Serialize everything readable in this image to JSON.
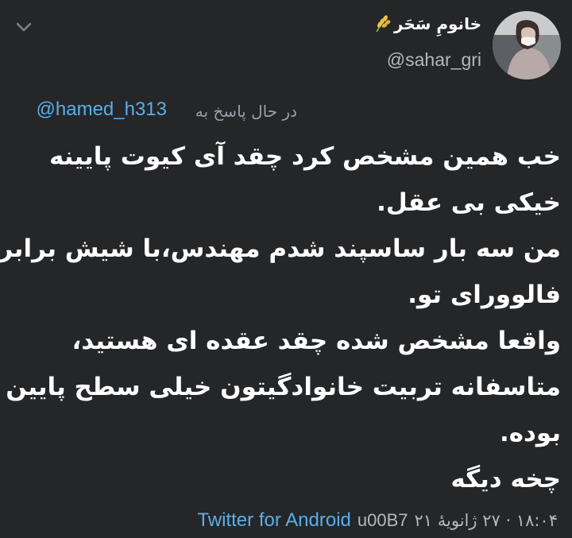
{
  "author": {
    "display_name": "خانومِ سَحَر",
    "handle": "@sahar_gri",
    "emoji_icon": "rice-ear-icon",
    "avatar_icon": "profile-photo"
  },
  "menu_icon": "chevron-down-icon",
  "reply": {
    "label": "در حال پاسخ به",
    "to_handle": "@hamed_h313"
  },
  "tweet": {
    "lines": [
      "خب همین مشخص کرد چقد آی کیوت پایینه",
      "خیکی بی عقل.",
      "من سه بار ساسپند شدم مهندس،با شیش برابر",
      "فالوورای تو.",
      "واقعا مشخص شده چقد عقده ای هستید،",
      "متاسفانه تربیت خانوادگیتون خیلی سطح پایین",
      "بوده.",
      "چخه دیگه"
    ]
  },
  "footer": {
    "time_date": "۱۸:۰۴ · ۲۷ ژانویهٔ ۲۱",
    "separator": "u00B7",
    "source": "Twitter for Android"
  },
  "colors": {
    "background": "#252628",
    "text": "#ffffff",
    "muted": "#b4b8bc",
    "link": "#5aaeea"
  }
}
